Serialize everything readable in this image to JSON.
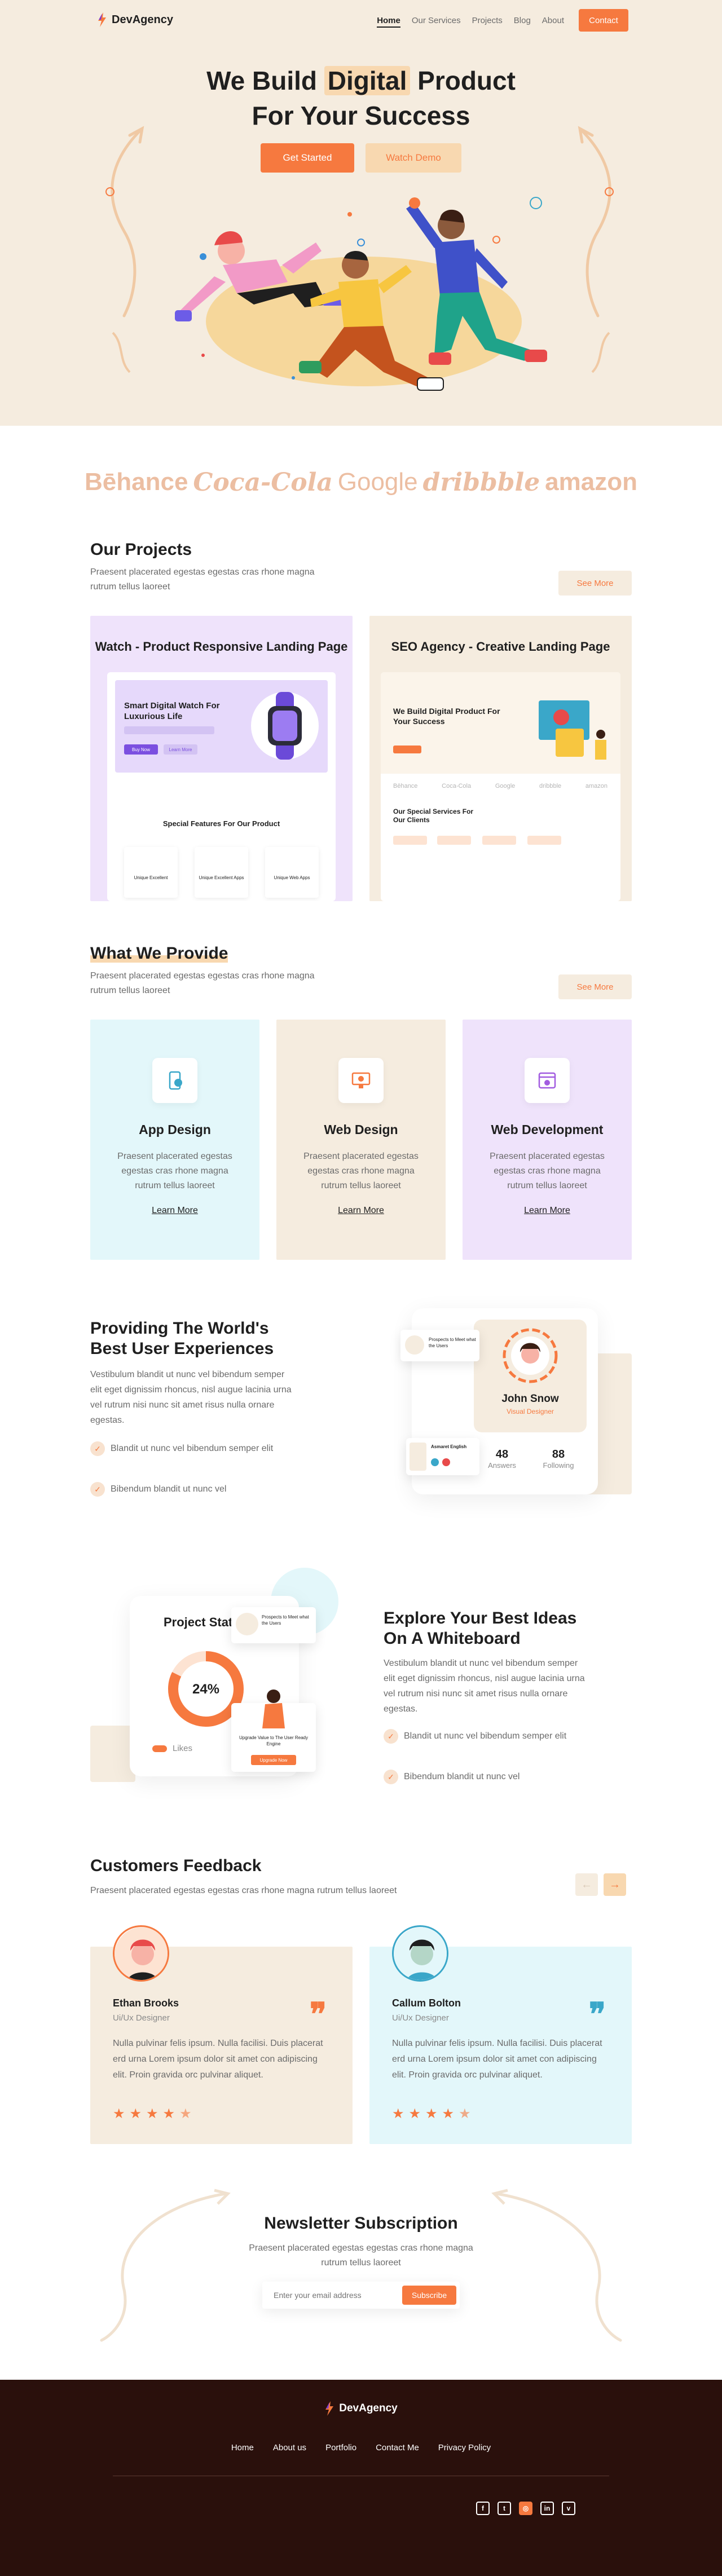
{
  "nav": {
    "brand": "DevAgency",
    "items": [
      "Home",
      "Our Services",
      "Projects",
      "Blog",
      "About"
    ],
    "contact": "Contact"
  },
  "hero": {
    "title_pre": "We Build ",
    "title_hl": "Digital",
    "title_post": " Product",
    "title_line2": "For Your Success",
    "get_started": "Get Started",
    "watch_demo": "Watch Demo"
  },
  "brands": [
    "Bēhance",
    "Coca-Cola",
    "Google",
    "dribbble",
    "amazon"
  ],
  "projects": {
    "title": "Our Projects",
    "subtitle": "Praesent placerated egestas egestas cras rhone magna rutrum tellus laoreet",
    "see_more": "See More",
    "cards": [
      {
        "title": "Watch - Product Responsive Landing Page",
        "mock_heading": "Smart Digital Watch For Luxurious Life",
        "mock_btn1": "Buy Now",
        "mock_btn2": "Learn More",
        "mock_section": "Special Features For Our Product",
        "mock_features": [
          "Unique Excellent",
          "Unique Excellent Apps",
          "Unique Web Apps"
        ]
      },
      {
        "title": "SEO Agency - Creative Landing Page",
        "mock_heading": "We Build Digital Product For Your Success",
        "mock_brands": [
          "Bēhance",
          "Coca-Cola",
          "Google",
          "dribbble",
          "amazon"
        ],
        "mock_section": "Our Special Services For Our Clients"
      }
    ]
  },
  "provide": {
    "title": "What We Provide",
    "subtitle": "Praesent placerated egestas egestas cras rhone magna rutrum tellus laoreet",
    "see_more": "See More",
    "services": [
      {
        "title": "App Design",
        "desc": "Praesent placerated egestas egestas cras rhone magna rutrum tellus laoreet",
        "link": "Learn More"
      },
      {
        "title": "Web Design",
        "desc": "Praesent placerated egestas egestas cras rhone magna rutrum tellus laoreet",
        "link": "Learn More"
      },
      {
        "title": "Web Development",
        "desc": "Praesent placerated egestas egestas cras rhone magna rutrum tellus laoreet",
        "link": "Learn More"
      }
    ]
  },
  "experience": {
    "title": "Providing The World's Best User Experiences",
    "desc": "Vestibulum blandit ut nunc vel bibendum semper elit eget dignissim rhoncus, nisl augue lacinia urna vel rutrum nisi nunc sit amet risus nulla ornare egestas.",
    "checks": [
      "Blandit ut nunc vel bibendum semper elit",
      "Bibendum blandit ut nunc vel"
    ],
    "profile_name": "John Snow",
    "profile_role": "Visual Designer",
    "answers_val": "48",
    "answers_lbl": "Answers",
    "following_val": "88",
    "following_lbl": "Following",
    "mini1": "Prospects to Meet what the Users",
    "mini2": "Asmaret English"
  },
  "whiteboard": {
    "title": "Explore Your Best Ideas On A Whiteboard",
    "desc": "Vestibulum blandit ut nunc vel bibendum semper elit eget dignissim rhoncus, nisl augue lacinia urna vel rutrum nisi nunc sit amet risus nulla ornare egestas.",
    "checks": [
      "Blandit ut nunc vel bibendum semper elit",
      "Bibendum blandit ut nunc vel"
    ],
    "card_title": "Project Stat",
    "percent": "24%",
    "legend": "Likes",
    "mini1": "Prospects to Meet what the Users",
    "mini2": "Upgrade Value to The User Ready Engine",
    "mini2_btn": "Upgrade Now"
  },
  "feedback": {
    "title": "Customers Feedback",
    "subtitle": "Praesent placerated egestas egestas cras rhone magna rutrum tellus laoreet",
    "items": [
      {
        "name": "Ethan Brooks",
        "role": "Ui/Ux Designer",
        "text": "Nulla pulvinar felis ipsum. Nulla facilisi. Duis placerat erd urna Lorem ipsum dolor sit amet con adipiscing elit. Proin gravida orc pulvinar aliquet.",
        "rating": 4.5
      },
      {
        "name": "Callum Bolton",
        "role": "Ui/Ux Designer",
        "text": "Nulla pulvinar felis ipsum. Nulla facilisi. Duis placerat erd urna Lorem ipsum dolor sit amet con adipiscing elit. Proin gravida orc pulvinar aliquet.",
        "rating": 4.5
      }
    ]
  },
  "newsletter": {
    "title": "Newsletter Subscription",
    "subtitle": "Praesent placerated egestas egestas cras rhone magna rutrum tellus laoreet",
    "placeholder": "Enter your email address",
    "button": "Subscribe"
  },
  "footer": {
    "brand": "DevAgency",
    "links": [
      "Home",
      "About us",
      "Portfolio",
      "Contact Me",
      "Privacy Policy"
    ],
    "social": [
      "facebook-icon",
      "twitter-icon",
      "dribbble-icon",
      "linkedin-icon",
      "vimeo-icon"
    ]
  },
  "colors": {
    "accent": "#f6793f",
    "cream": "#f5ecdf",
    "peach": "#f8d8b0",
    "lavender": "#efe3fb",
    "cyan": "#e3f7fa",
    "footer": "#2a100c"
  }
}
